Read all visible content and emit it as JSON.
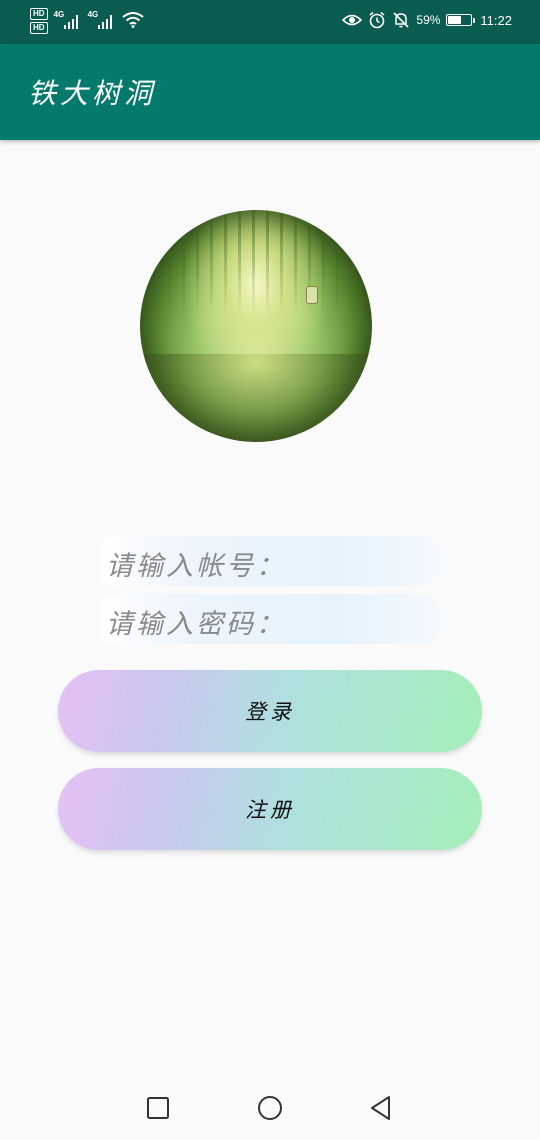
{
  "status_bar": {
    "hd1": "HD",
    "hd2": "HD",
    "sim1": "4G",
    "sim2": "4G",
    "battery_percent": "59%",
    "battery_level": 0.59,
    "time": "11:22",
    "icons": [
      "eye-comfort-icon",
      "alarm-icon",
      "bell-muted-icon",
      "wifi-icon",
      "signal-icon"
    ]
  },
  "app_bar": {
    "title": "铁大树洞"
  },
  "avatar": {
    "icon": "forest-avatar-image"
  },
  "form": {
    "account_placeholder": "请输入帐号：",
    "password_placeholder": "请输入密码："
  },
  "buttons": {
    "login_label": "登录",
    "register_label": "注册",
    "gradient_colors": [
      "#e6bff6",
      "#a5eeb8"
    ]
  },
  "nav": {
    "icons": [
      "square-recent-icon",
      "circle-home-icon",
      "triangle-back-icon"
    ]
  },
  "colors": {
    "status_bar": "#0b5c50",
    "app_bar": "#037a6c",
    "background": "#fafafa"
  }
}
